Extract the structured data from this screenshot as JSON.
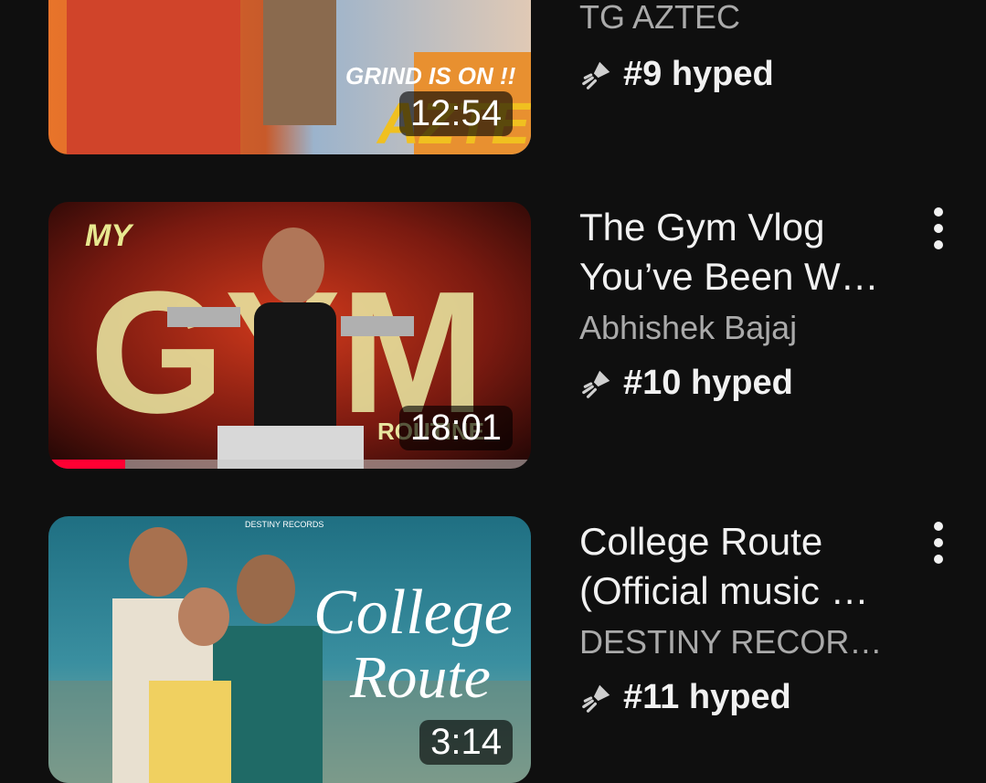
{
  "videos": [
    {
      "title": "",
      "channel": "TG AZTEC",
      "hype": "#9 hyped",
      "duration": "12:54",
      "thumb_texts": [
        "GRIND IS ON !!",
        "AZTEC"
      ]
    },
    {
      "title_line1": "The Gym Vlog",
      "title_line2": "You’ve Been W…",
      "channel": "Abhishek Bajaj",
      "hype": "#10 hyped",
      "duration": "18:01",
      "watch_progress": 0.16,
      "thumb_texts": [
        "MY",
        "GYM",
        "ROUTINE"
      ]
    },
    {
      "title_line1": "College Route",
      "title_line2": "(Official music …",
      "channel": "DESTINY RECORD…",
      "hype": "#11 hyped",
      "duration": "3:14",
      "thumb_texts": [
        "College",
        "Route",
        "DESTINY RECORDS"
      ]
    }
  ],
  "icons": {
    "hype": "hype-rocket-icon",
    "more": "more-vert-icon"
  },
  "colors": {
    "progress": "#ff0033",
    "background": "#0f0f0f",
    "secondary_text": "#aaaaaa"
  }
}
